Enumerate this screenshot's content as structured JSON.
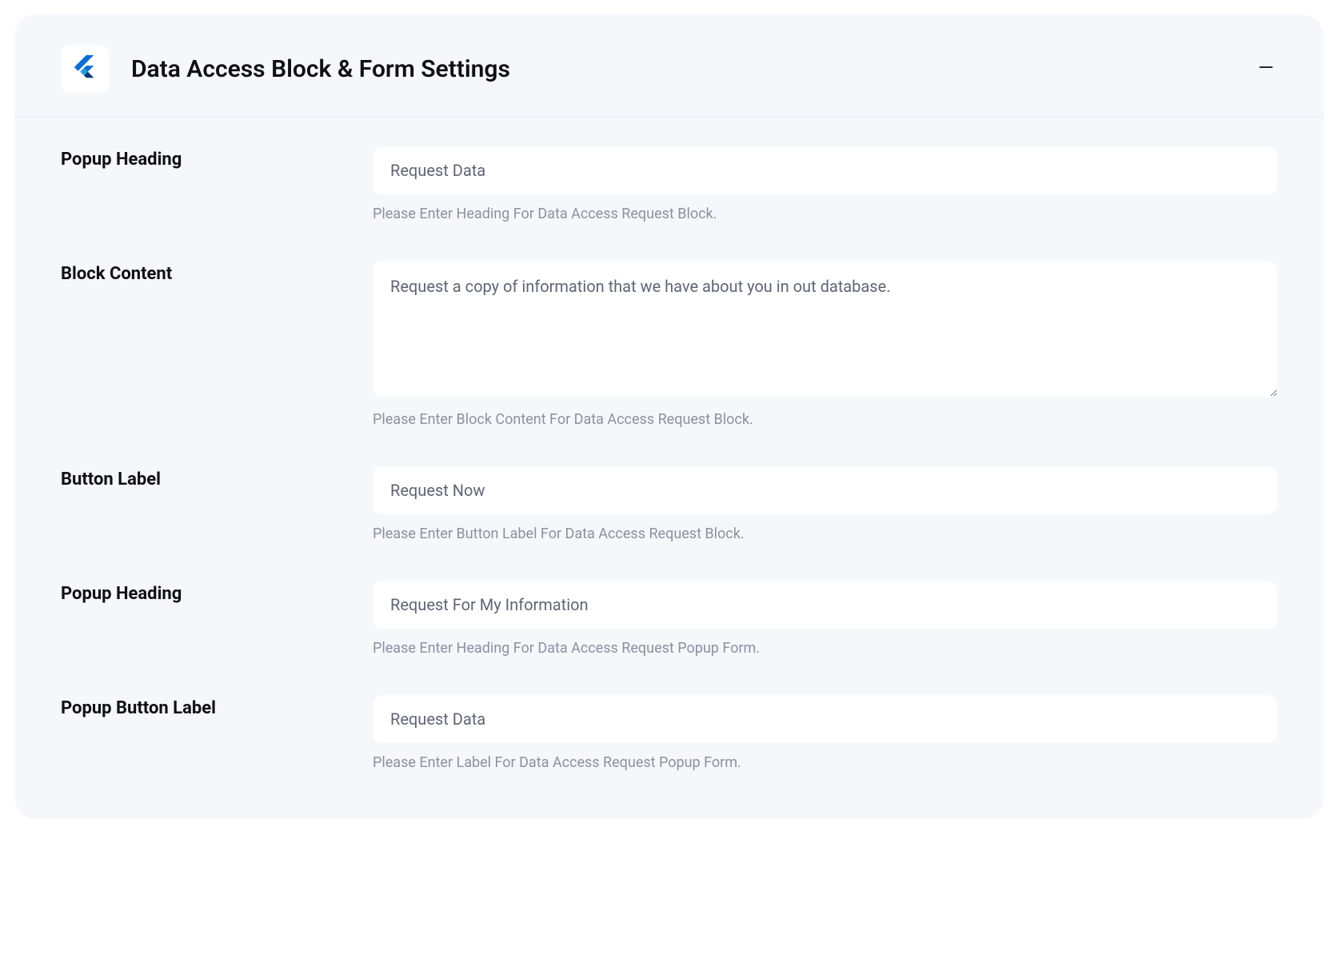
{
  "panel": {
    "title": "Data Access Block & Form Settings"
  },
  "fields": {
    "popup_heading_1": {
      "label": "Popup Heading",
      "value": "Request Data",
      "help": "Please Enter Heading For Data Access Request Block."
    },
    "block_content": {
      "label": "Block Content",
      "value": "Request a copy of information that we have about you in out database.",
      "help": "Please Enter Block Content For Data Access Request Block."
    },
    "button_label": {
      "label": "Button Label",
      "value": "Request Now",
      "help": "Please Enter Button Label For Data Access Request Block."
    },
    "popup_heading_2": {
      "label": "Popup Heading",
      "value": "Request For My Information",
      "help": "Please Enter Heading For Data Access Request Popup Form."
    },
    "popup_button_label": {
      "label": "Popup Button Label",
      "value": "Request Data",
      "help": "Please Enter Label For Data Access Request Popup Form."
    }
  }
}
